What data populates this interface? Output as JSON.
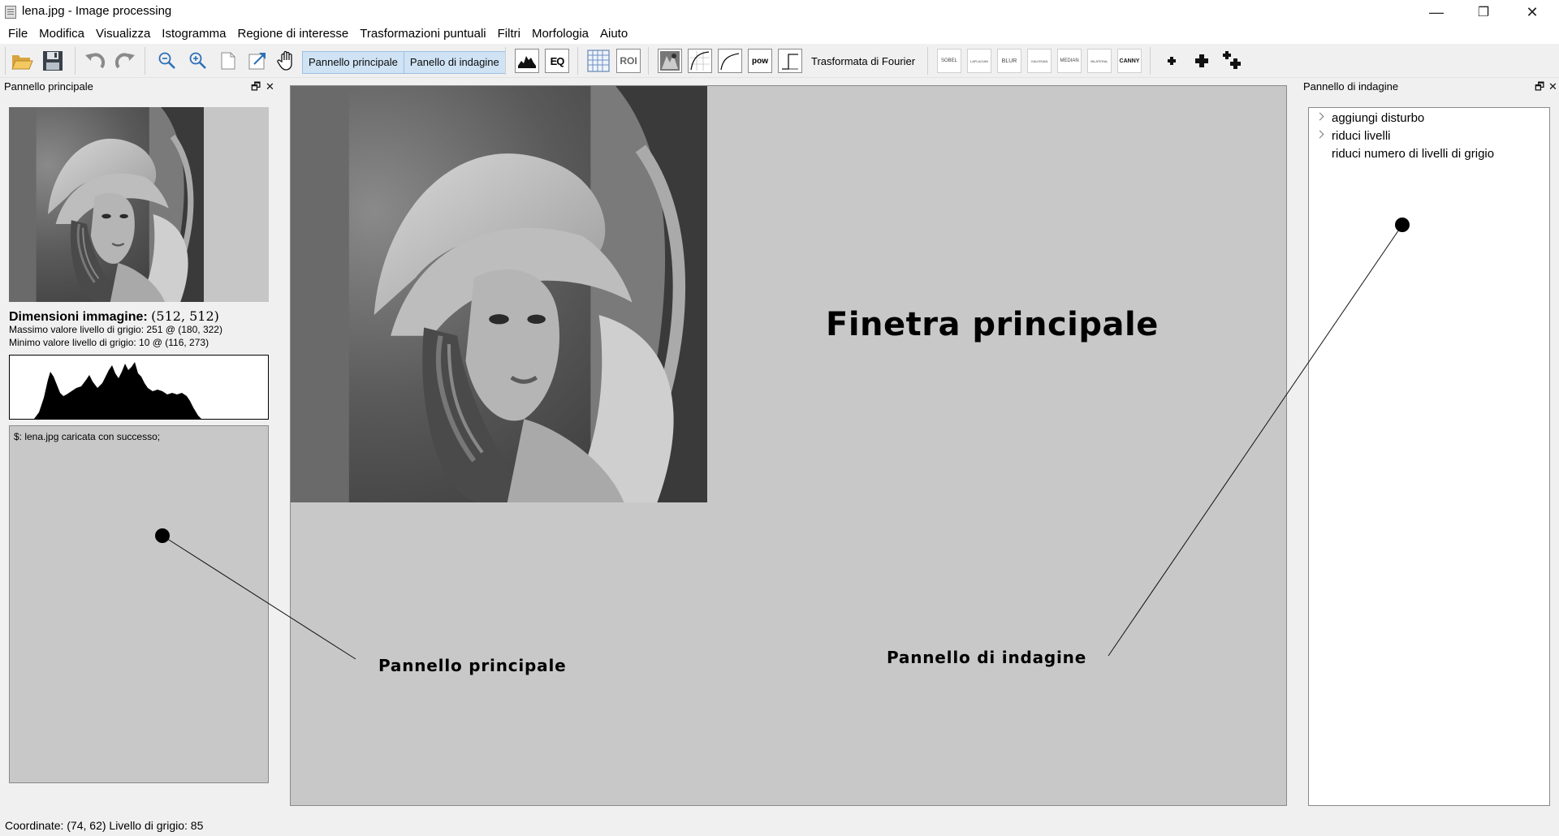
{
  "window": {
    "title": "lena.jpg - Image processing",
    "minimize": "—",
    "maximize": "❐",
    "close": "✕"
  },
  "menu": [
    "File",
    "Modifica",
    "Visualizza",
    "Istogramma",
    "Regione di interesse",
    "Trasformazioni puntuali",
    "Filtri",
    "Morfologia",
    "Aiuto"
  ],
  "toolbar": {
    "toggles": [
      "Pannello principale",
      "Panello di indagine"
    ],
    "eq": "EQ",
    "roi": "ROI",
    "pow": "pow",
    "fourier": "Trasformata di Fourier",
    "filters": [
      "SOBEL",
      "LAPLACIAN",
      "BLUR",
      "GAUSSIAN",
      "MEDIAN",
      "BILATERAL",
      "CANNY"
    ],
    "icons": [
      "open-folder-icon",
      "save-icon",
      "undo-icon",
      "redo-icon",
      "zoom-out-icon",
      "zoom-in-icon",
      "fit-page-icon",
      "expand-icon",
      "hand-icon"
    ]
  },
  "left_panel": {
    "title": "Pannello principale",
    "dims_label": "Dimensioni immagine:",
    "dims_value": "(512, 512)",
    "max_line": "Massimo valore livello di grigio: 251 @ (180, 322)",
    "min_line": "Minimo valore livello di grigio: 10 @ (116, 273)",
    "console": "$: lena.jpg caricata con successo;"
  },
  "right_panel": {
    "title": "Pannello di indagine",
    "tree": [
      {
        "label": "aggiungi disturbo",
        "expandable": true
      },
      {
        "label": "riduci livelli",
        "expandable": true
      },
      {
        "label": "riduci numero di livelli di grigio",
        "expandable": false
      }
    ]
  },
  "annotations": {
    "main": "Finetra principale",
    "left": "Pannello principale",
    "right": "Pannello di indagine"
  },
  "status": "Coordinate: (74,  62) Livello di grigio:  85",
  "colors": {
    "toggle_bg": "#cfe3f5",
    "work_bg": "#c8c8c8"
  }
}
